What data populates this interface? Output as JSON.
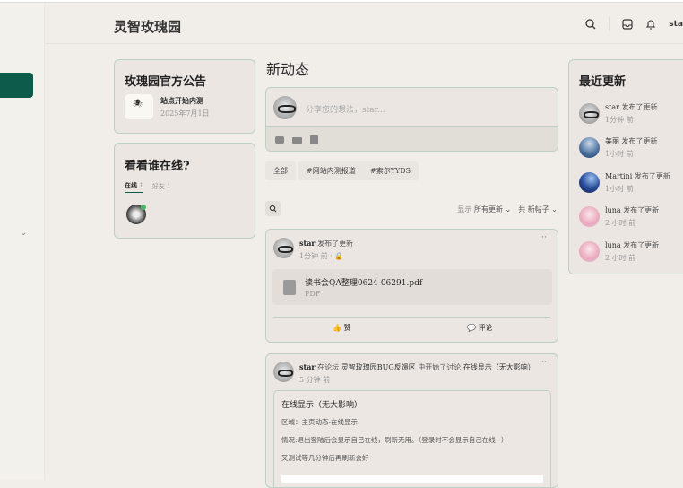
{
  "header": {
    "brand": "灵智玫瑰园",
    "user": "sta"
  },
  "announcement": {
    "title": "玫瑰园官方公告",
    "item_title": "站点开始内测",
    "item_date": "2025年7月1日"
  },
  "online": {
    "title": "看看谁在线?",
    "tabs": [
      {
        "label": "在线",
        "count": "1"
      },
      {
        "label": "好友",
        "count": "1"
      }
    ]
  },
  "feed": {
    "title": "新动态",
    "composer_placeholder": "分享您的想法，star...",
    "tags": [
      "全部",
      "#网站内测报道",
      "#索尔YYDS"
    ],
    "filter_show_label": "显示",
    "filter_show_value": "所有更新",
    "filter_count_label": "共",
    "filter_count_value": "新帖子"
  },
  "post1": {
    "user": "star",
    "action": "发布了更新",
    "time": "1分钟 前",
    "file_name": "读书会QA整理0624-06291.pdf",
    "file_type": "PDF",
    "like": "赞",
    "comment": "评论"
  },
  "post2": {
    "user": "star",
    "action1": "在论坛",
    "forum": "灵智玫瑰园BUG反馈区",
    "action2": "中开始了讨论",
    "topic": "在线显示（无大影响）",
    "time": "5 分钟 前",
    "body_title": "在线显示（无大影响）",
    "lines": [
      "区域：主页动态-在线显示",
      "情况:退出登陆后会显示自己在线，刷新无用。（登录时不会显示自己在线~）",
      "又测试等几分钟后再刷新会好"
    ]
  },
  "recent": {
    "title": "最近更新",
    "items": [
      {
        "user": "star",
        "action": "发布了更新",
        "time": "1分钟 前",
        "avatar": "glasses"
      },
      {
        "user": "美丽",
        "action": "发布了更新",
        "time": "1小时 前",
        "avatar": "blue"
      },
      {
        "user": "Martini",
        "action": "发布了更新",
        "time": "1小时 前",
        "avatar": "night"
      },
      {
        "user": "luna",
        "action": "发布了更新",
        "time": "2 小时 前",
        "avatar": "pink"
      },
      {
        "user": "luna",
        "action": "发布了更新",
        "time": "2 小时 前",
        "avatar": "pink"
      }
    ]
  },
  "colors": {
    "accent": "#0d5c4b",
    "online_dot": "#4cba6a",
    "card_border": "#bcd0c5"
  }
}
